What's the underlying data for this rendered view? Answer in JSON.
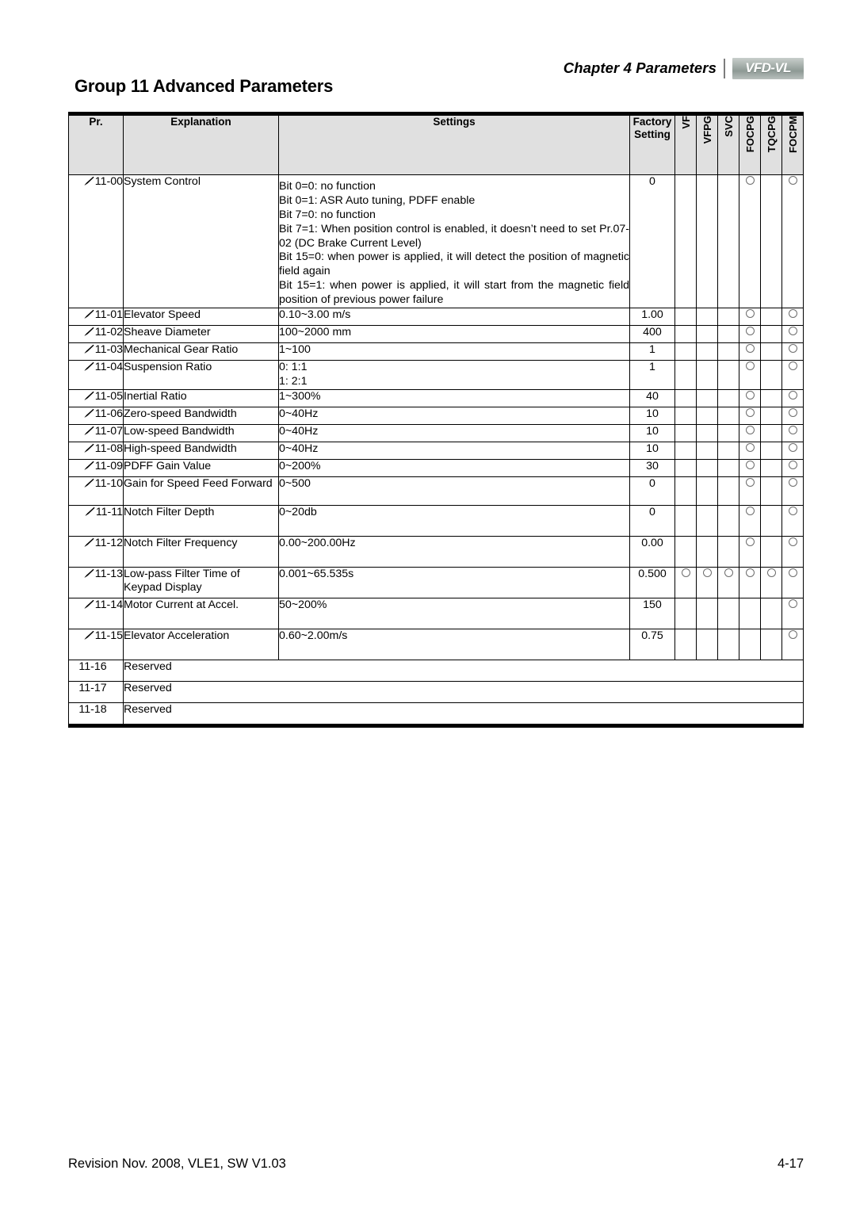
{
  "header": {
    "chapter": "Chapter 4 Parameters",
    "separator": "|",
    "logo_text": "VFD-VL"
  },
  "title": "Group 11 Advanced Parameters",
  "table": {
    "columns": {
      "pr": "Pr.",
      "explanation": "Explanation",
      "settings": "Settings",
      "factory_setting": "Factory Setting",
      "factory_setting_line1": "Factory",
      "factory_setting_line2": "Setting",
      "modes": [
        "VF",
        "VFPG",
        "SVC",
        "FOCPG",
        "TQCPG",
        "FOCPM"
      ]
    },
    "rows": [
      {
        "pr": "11-00",
        "editable": true,
        "explanation": "System Control",
        "settings_lines": [
          "Bit 0=0: no function",
          "Bit 0=1: ASR Auto tuning, PDFF enable",
          "Bit 7=0: no function",
          "Bit 7=1: When position control is enabled, it doesn’t need to set Pr.07-02 (DC Brake Current Level)",
          "Bit 15=0: when power is applied, it will detect the position of magnetic field again",
          "Bit 15=1: when power is applied, it will start from the magnetic field position of previous power failure"
        ],
        "factory": "0",
        "modes": [
          false,
          false,
          false,
          true,
          false,
          true
        ]
      },
      {
        "pr": "11-01",
        "editable": true,
        "explanation": "Elevator Speed",
        "settings_lines": [
          "0.10~3.00 m/s"
        ],
        "factory": "1.00",
        "modes": [
          false,
          false,
          false,
          true,
          false,
          true
        ]
      },
      {
        "pr": "11-02",
        "editable": true,
        "explanation": "Sheave Diameter",
        "settings_lines": [
          "100~2000 mm"
        ],
        "factory": "400",
        "modes": [
          false,
          false,
          false,
          true,
          false,
          true
        ]
      },
      {
        "pr": "11-03",
        "editable": true,
        "explanation": "Mechanical Gear Ratio",
        "settings_lines": [
          "1~100"
        ],
        "factory": "1",
        "modes": [
          false,
          false,
          false,
          true,
          false,
          true
        ]
      },
      {
        "pr": "11-04",
        "editable": true,
        "explanation": "Suspension Ratio",
        "settings_lines": [
          "0: 1:1",
          "1: 2:1"
        ],
        "factory": "1",
        "modes": [
          false,
          false,
          false,
          true,
          false,
          true
        ]
      },
      {
        "pr": "11-05",
        "editable": true,
        "explanation": "Inertial Ratio",
        "settings_lines": [
          "1~300%"
        ],
        "factory": "40",
        "modes": [
          false,
          false,
          false,
          true,
          false,
          true
        ]
      },
      {
        "pr": "11-06",
        "editable": true,
        "explanation": "Zero-speed Bandwidth",
        "settings_lines": [
          "0~40Hz"
        ],
        "factory": "10",
        "modes": [
          false,
          false,
          false,
          true,
          false,
          true
        ]
      },
      {
        "pr": "11-07",
        "editable": true,
        "explanation": "Low-speed Bandwidth",
        "settings_lines": [
          "0~40Hz"
        ],
        "factory": "10",
        "modes": [
          false,
          false,
          false,
          true,
          false,
          true
        ]
      },
      {
        "pr": "11-08",
        "editable": true,
        "explanation": "High-speed Bandwidth",
        "settings_lines": [
          "0~40Hz"
        ],
        "factory": "10",
        "modes": [
          false,
          false,
          false,
          true,
          false,
          true
        ]
      },
      {
        "pr": "11-09",
        "editable": true,
        "explanation": "PDFF Gain Value",
        "settings_lines": [
          "0~200%"
        ],
        "factory": "30",
        "modes": [
          false,
          false,
          false,
          true,
          false,
          true
        ]
      },
      {
        "pr": "11-10",
        "editable": true,
        "explanation": "Gain for Speed Feed Forward",
        "settings_lines": [
          "0~500"
        ],
        "factory": "0",
        "modes": [
          false,
          false,
          false,
          true,
          false,
          true
        ]
      },
      {
        "pr": "11-11",
        "editable": true,
        "explanation": "Notch Filter Depth",
        "settings_lines": [
          "0~20db"
        ],
        "factory": "0",
        "modes": [
          false,
          false,
          false,
          true,
          false,
          true
        ]
      },
      {
        "pr": "11-12",
        "editable": true,
        "explanation": "Notch Filter Frequency",
        "settings_lines": [
          "0.00~200.00Hz"
        ],
        "factory": "0.00",
        "modes": [
          false,
          false,
          false,
          true,
          false,
          true
        ]
      },
      {
        "pr": "11-13",
        "editable": true,
        "explanation": "Low-pass Filter Time of Keypad Display",
        "settings_lines": [
          "0.001~65.535s"
        ],
        "factory": "0.500",
        "modes": [
          true,
          true,
          true,
          true,
          true,
          true
        ]
      },
      {
        "pr": "11-14",
        "editable": true,
        "explanation": "Motor Current at Accel.",
        "settings_lines": [
          "50~200%"
        ],
        "factory": "150",
        "modes": [
          false,
          false,
          false,
          false,
          false,
          true
        ]
      },
      {
        "pr": "11-15",
        "editable": true,
        "explanation": "Elevator Acceleration",
        "settings_lines": [
          "0.60~2.00m/s"
        ],
        "factory": "0.75",
        "modes": [
          false,
          false,
          false,
          false,
          false,
          true
        ]
      }
    ],
    "reserved_rows": [
      {
        "pr": "11-16",
        "label": "Reserved"
      },
      {
        "pr": "11-17",
        "label": "Reserved"
      },
      {
        "pr": "11-18",
        "label": "Reserved"
      }
    ]
  },
  "footer": {
    "revision": "Revision Nov. 2008, VLE1, SW V1.03",
    "page": "4-17"
  }
}
